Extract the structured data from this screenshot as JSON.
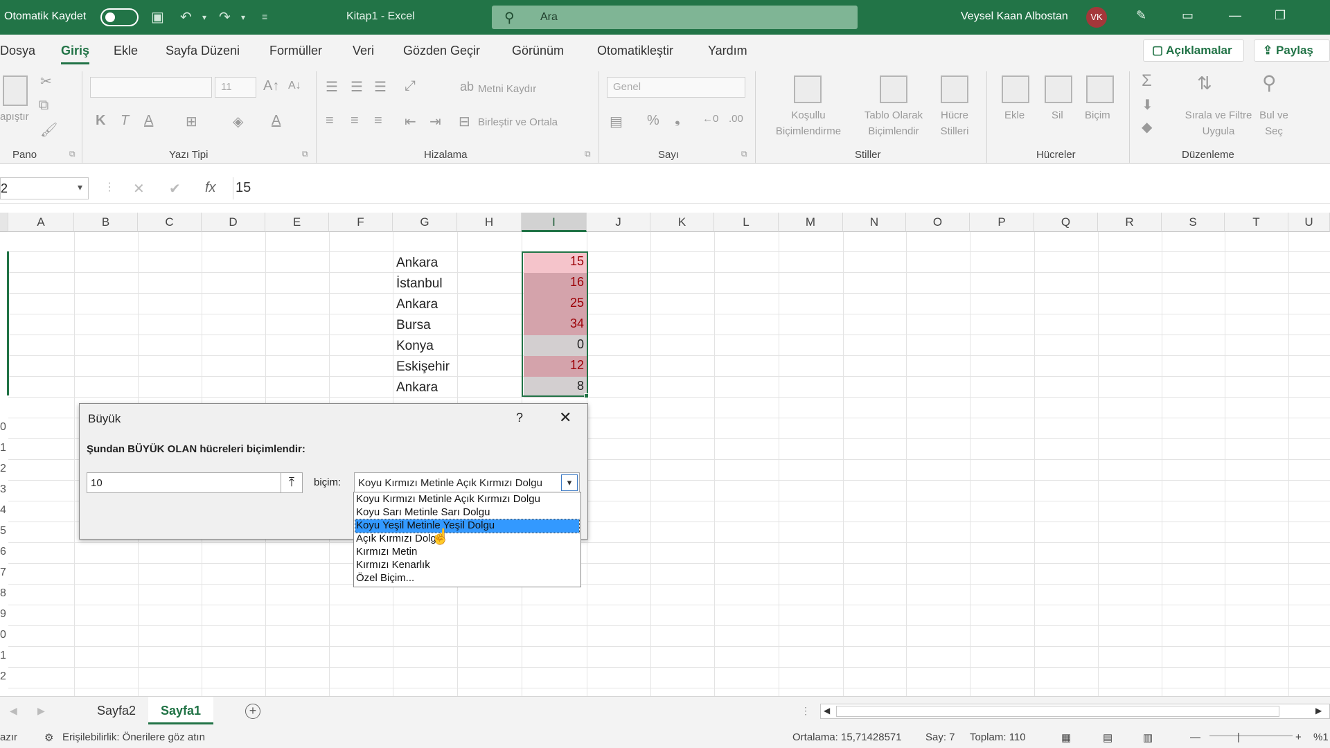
{
  "titlebar": {
    "autosave_label": "Otomatik Kaydet",
    "document_title": "Kitap1  -  Excel",
    "search_placeholder": "Ara",
    "user_name": "Veysel Kaan Albostan",
    "user_initials": "VK"
  },
  "menu": {
    "tabs": [
      "Dosya",
      "Giriş",
      "Ekle",
      "Sayfa Düzeni",
      "Formüller",
      "Veri",
      "Gözden Geçir",
      "Görünüm",
      "Otomatikleştir",
      "Yardım"
    ],
    "active_tab": "Giriş",
    "comments_label": "Açıklamalar",
    "share_label": "Paylaş"
  },
  "ribbon": {
    "groups": [
      "Pano",
      "Yazı Tipi",
      "Hizalama",
      "Sayı",
      "Stiller",
      "Hücreler",
      "Düzenleme"
    ],
    "paste_label": "apıştır",
    "font_size": "11",
    "wrap_text": "Metni Kaydır",
    "merge_center": "Birleştir ve Ortala",
    "number_format": "Genel",
    "conditional_formatting": [
      "Koşullu",
      "Biçimlendirme"
    ],
    "format_as_table": [
      "Tablo Olarak",
      "Biçimlendir"
    ],
    "cell_styles": [
      "Hücre",
      "Stilleri"
    ],
    "insert": "Ekle",
    "delete": "Sil",
    "format": "Biçim",
    "sort_filter": [
      "Sırala ve Filtre",
      "Uygula"
    ],
    "find_select": [
      "Bul ve",
      "Seç"
    ],
    "bold": "K",
    "italic": "T",
    "underline": "A"
  },
  "formula_bar": {
    "name_box": "2",
    "formula_value": "15"
  },
  "grid": {
    "columns": [
      "A",
      "B",
      "C",
      "D",
      "E",
      "F",
      "G",
      "H",
      "I",
      "J",
      "K",
      "L",
      "M",
      "N",
      "O",
      "P",
      "Q",
      "R",
      "S",
      "T",
      "U"
    ],
    "selected_column": "I",
    "row_numbers": [
      "0",
      "1",
      "2",
      "3",
      "4",
      "5",
      "6",
      "7",
      "8",
      "9",
      "0",
      "1",
      "2",
      "3"
    ],
    "cities": [
      "Ankara",
      "İstanbul",
      "Ankara",
      "Bursa",
      "Konya",
      "Eskişehir",
      "Ankara"
    ],
    "values": [
      "15",
      "16",
      "25",
      "34",
      "0",
      "12",
      "8"
    ],
    "highlight_colors": {
      "light_red_fill": "#ffc7ce",
      "dark_red_text": "#9c0006",
      "preview_fill": "#d4a3ab",
      "neutral_fill": "#d3cfd0"
    }
  },
  "dialog": {
    "title": "Büyük",
    "help": "?",
    "prompt": "Şundan BÜYÜK OLAN hücreleri biçimlendir:",
    "input_value": "10",
    "format_label": "biçim:",
    "selected_format": "Koyu Kırmızı Metinle Açık Kırmızı Dolgu",
    "options": [
      "Koyu Kırmızı Metinle Açık Kırmızı Dolgu",
      "Koyu Sarı Metinle Sarı Dolgu",
      "Koyu Yeşil Metinle Yeşil Dolgu",
      "Açık Kırmızı Dolgu",
      "Kırmızı Metin",
      "Kırmızı Kenarlık",
      "Özel Biçim..."
    ],
    "highlighted_option": "Koyu Yeşil Metinle Yeşil Dolgu"
  },
  "sheets": {
    "tabs": [
      "Sayfa2",
      "Sayfa1"
    ],
    "active": "Sayfa1"
  },
  "status": {
    "mode": "azır",
    "accessibility": "Erişilebilirlik: Önerilere göz atın",
    "average": "Ortalama: 15,71428571",
    "count": "Say: 7",
    "sum": "Toplam: 110",
    "zoom": "%1"
  }
}
